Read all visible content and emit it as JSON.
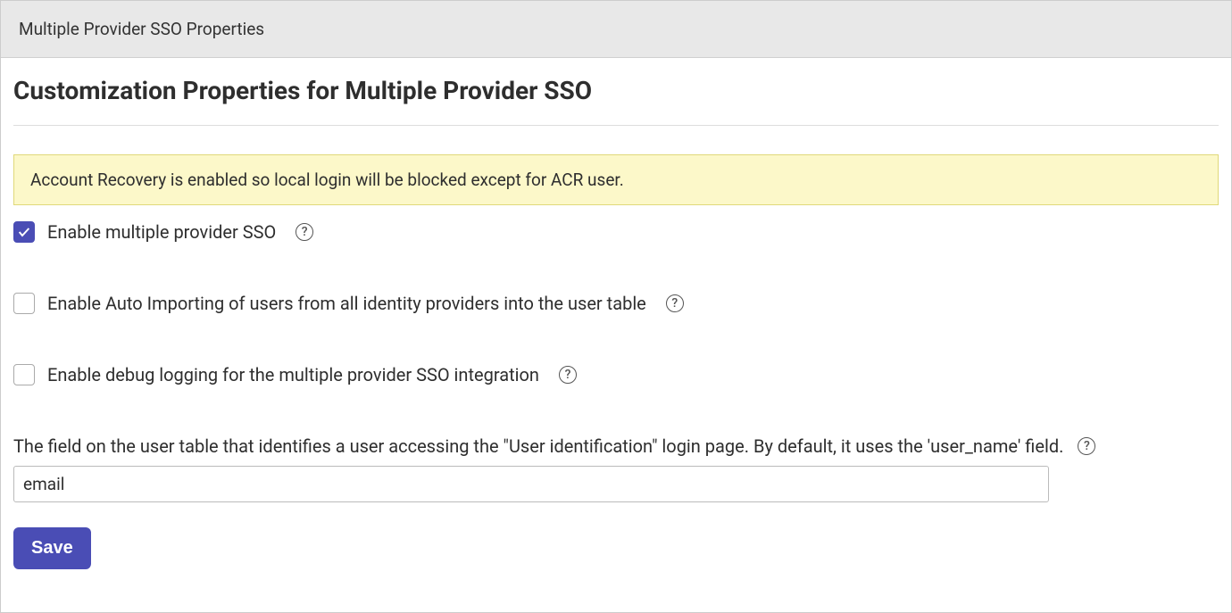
{
  "header": {
    "title": "Multiple Provider SSO Properties"
  },
  "page": {
    "title": "Customization Properties for Multiple Provider SSO"
  },
  "alert": {
    "message": "Account Recovery is enabled so local login will be blocked except for ACR user."
  },
  "fields": {
    "enable_sso": {
      "label": "Enable multiple provider SSO",
      "checked": true
    },
    "auto_import": {
      "label": "Enable Auto Importing of users from all identity providers into the user table",
      "checked": false
    },
    "debug_logging": {
      "label": "Enable debug logging for the multiple provider SSO integration",
      "checked": false
    },
    "user_field": {
      "label": "The field on the user table that identifies a user accessing the \"User identification\" login page. By default, it uses the 'user_name' field.",
      "value": "email"
    }
  },
  "buttons": {
    "save": "Save"
  },
  "help_icon_glyph": "?"
}
